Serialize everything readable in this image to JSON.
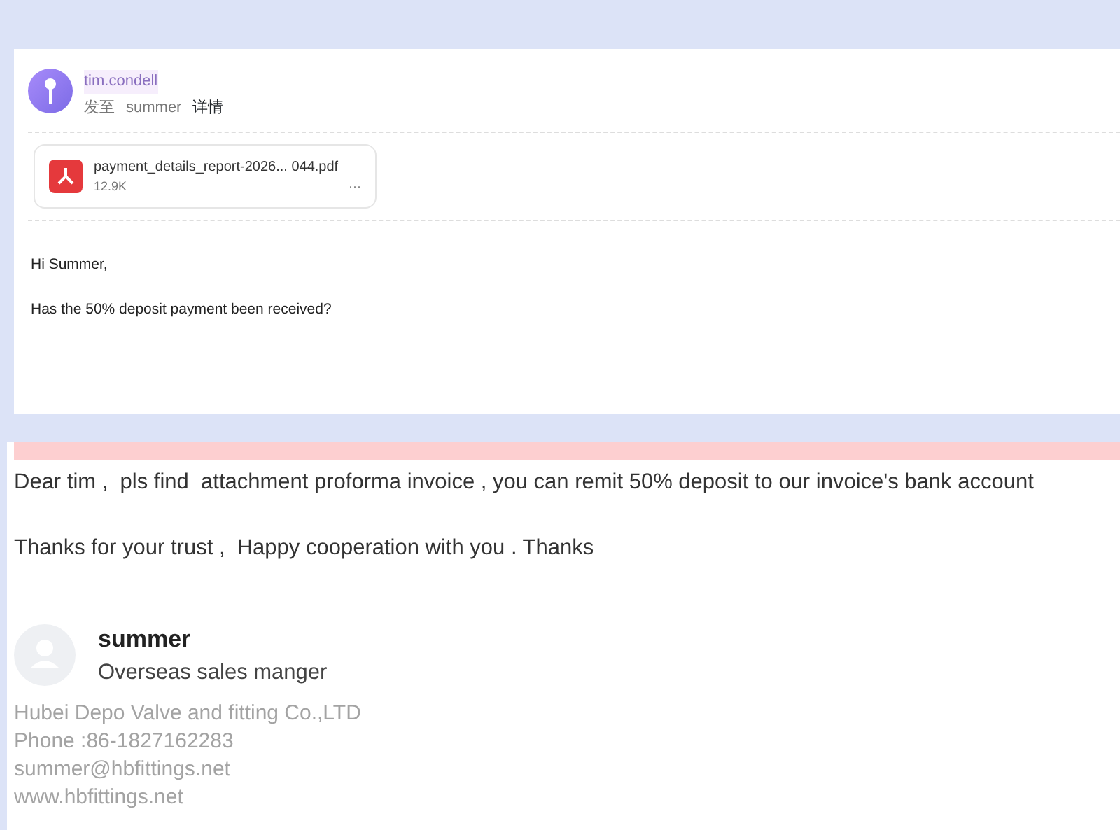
{
  "quoted_message": {
    "sender": "tim.condell",
    "recipient_prefix": "发至",
    "recipient": "summer",
    "details_link": "详情",
    "attachment": {
      "name": "payment_details_report-2026... 044.pdf",
      "size": "12.9K",
      "more": "···"
    },
    "body": [
      "Hi Summer,",
      "Has the 50% deposit payment been received?"
    ]
  },
  "reply": {
    "body": [
      "Dear tim ,  pls find  attachment proforma invoice , you can remit 50% deposit to our invoice's bank account",
      "Thanks for your trust ,  Happy cooperation with you . Thanks"
    ],
    "signature": {
      "name": "summer",
      "title": "Overseas sales manger",
      "lines": [
        "Hubei Depo Valve and fitting Co.,LTD",
        "Phone :86-1827162283",
        "summer@hbfittings.net",
        "www.hbfittings.net"
      ]
    }
  }
}
